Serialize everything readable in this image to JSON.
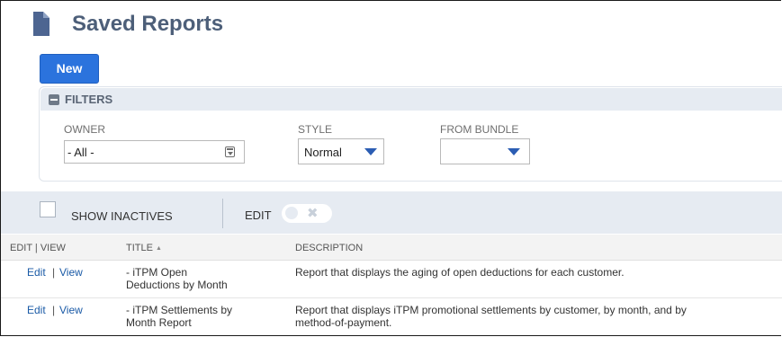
{
  "page": {
    "title": "Saved Reports"
  },
  "toolbar": {
    "new_label": "New"
  },
  "filters": {
    "header": "FILTERS",
    "owner": {
      "label": "OWNER",
      "value": "- All -"
    },
    "style": {
      "label": "STYLE",
      "value": "Normal"
    },
    "bundle": {
      "label": "FROM BUNDLE",
      "value": ""
    }
  },
  "list_toolbar": {
    "show_inactives_label": "SHOW INACTIVES",
    "show_inactives_checked": false,
    "edit_label": "EDIT",
    "edit_toggle_on": false
  },
  "table": {
    "columns": [
      "EDIT | VIEW",
      "TITLE",
      "DESCRIPTION"
    ],
    "sort_indicator": "▲",
    "rows": [
      {
        "edit": "Edit",
        "sep": "|",
        "view": "View",
        "title_line1": "- iTPM Open",
        "title_line2": "Deductions by Month",
        "desc_line1": "Report that displays the aging of open deductions for each customer.",
        "desc_line2": ""
      },
      {
        "edit": "Edit",
        "sep": "|",
        "view": "View",
        "title_line1": "- iTPM Settlements by",
        "title_line2": "Month Report",
        "desc_line1": "Report that displays iTPM promotional settlements by customer, by month, and by",
        "desc_line2": "method-of-payment."
      }
    ]
  },
  "colors": {
    "accent": "#2b73dd",
    "title": "#4d5f79",
    "link": "#1a5aa6",
    "panel": "#e6ebf2"
  }
}
